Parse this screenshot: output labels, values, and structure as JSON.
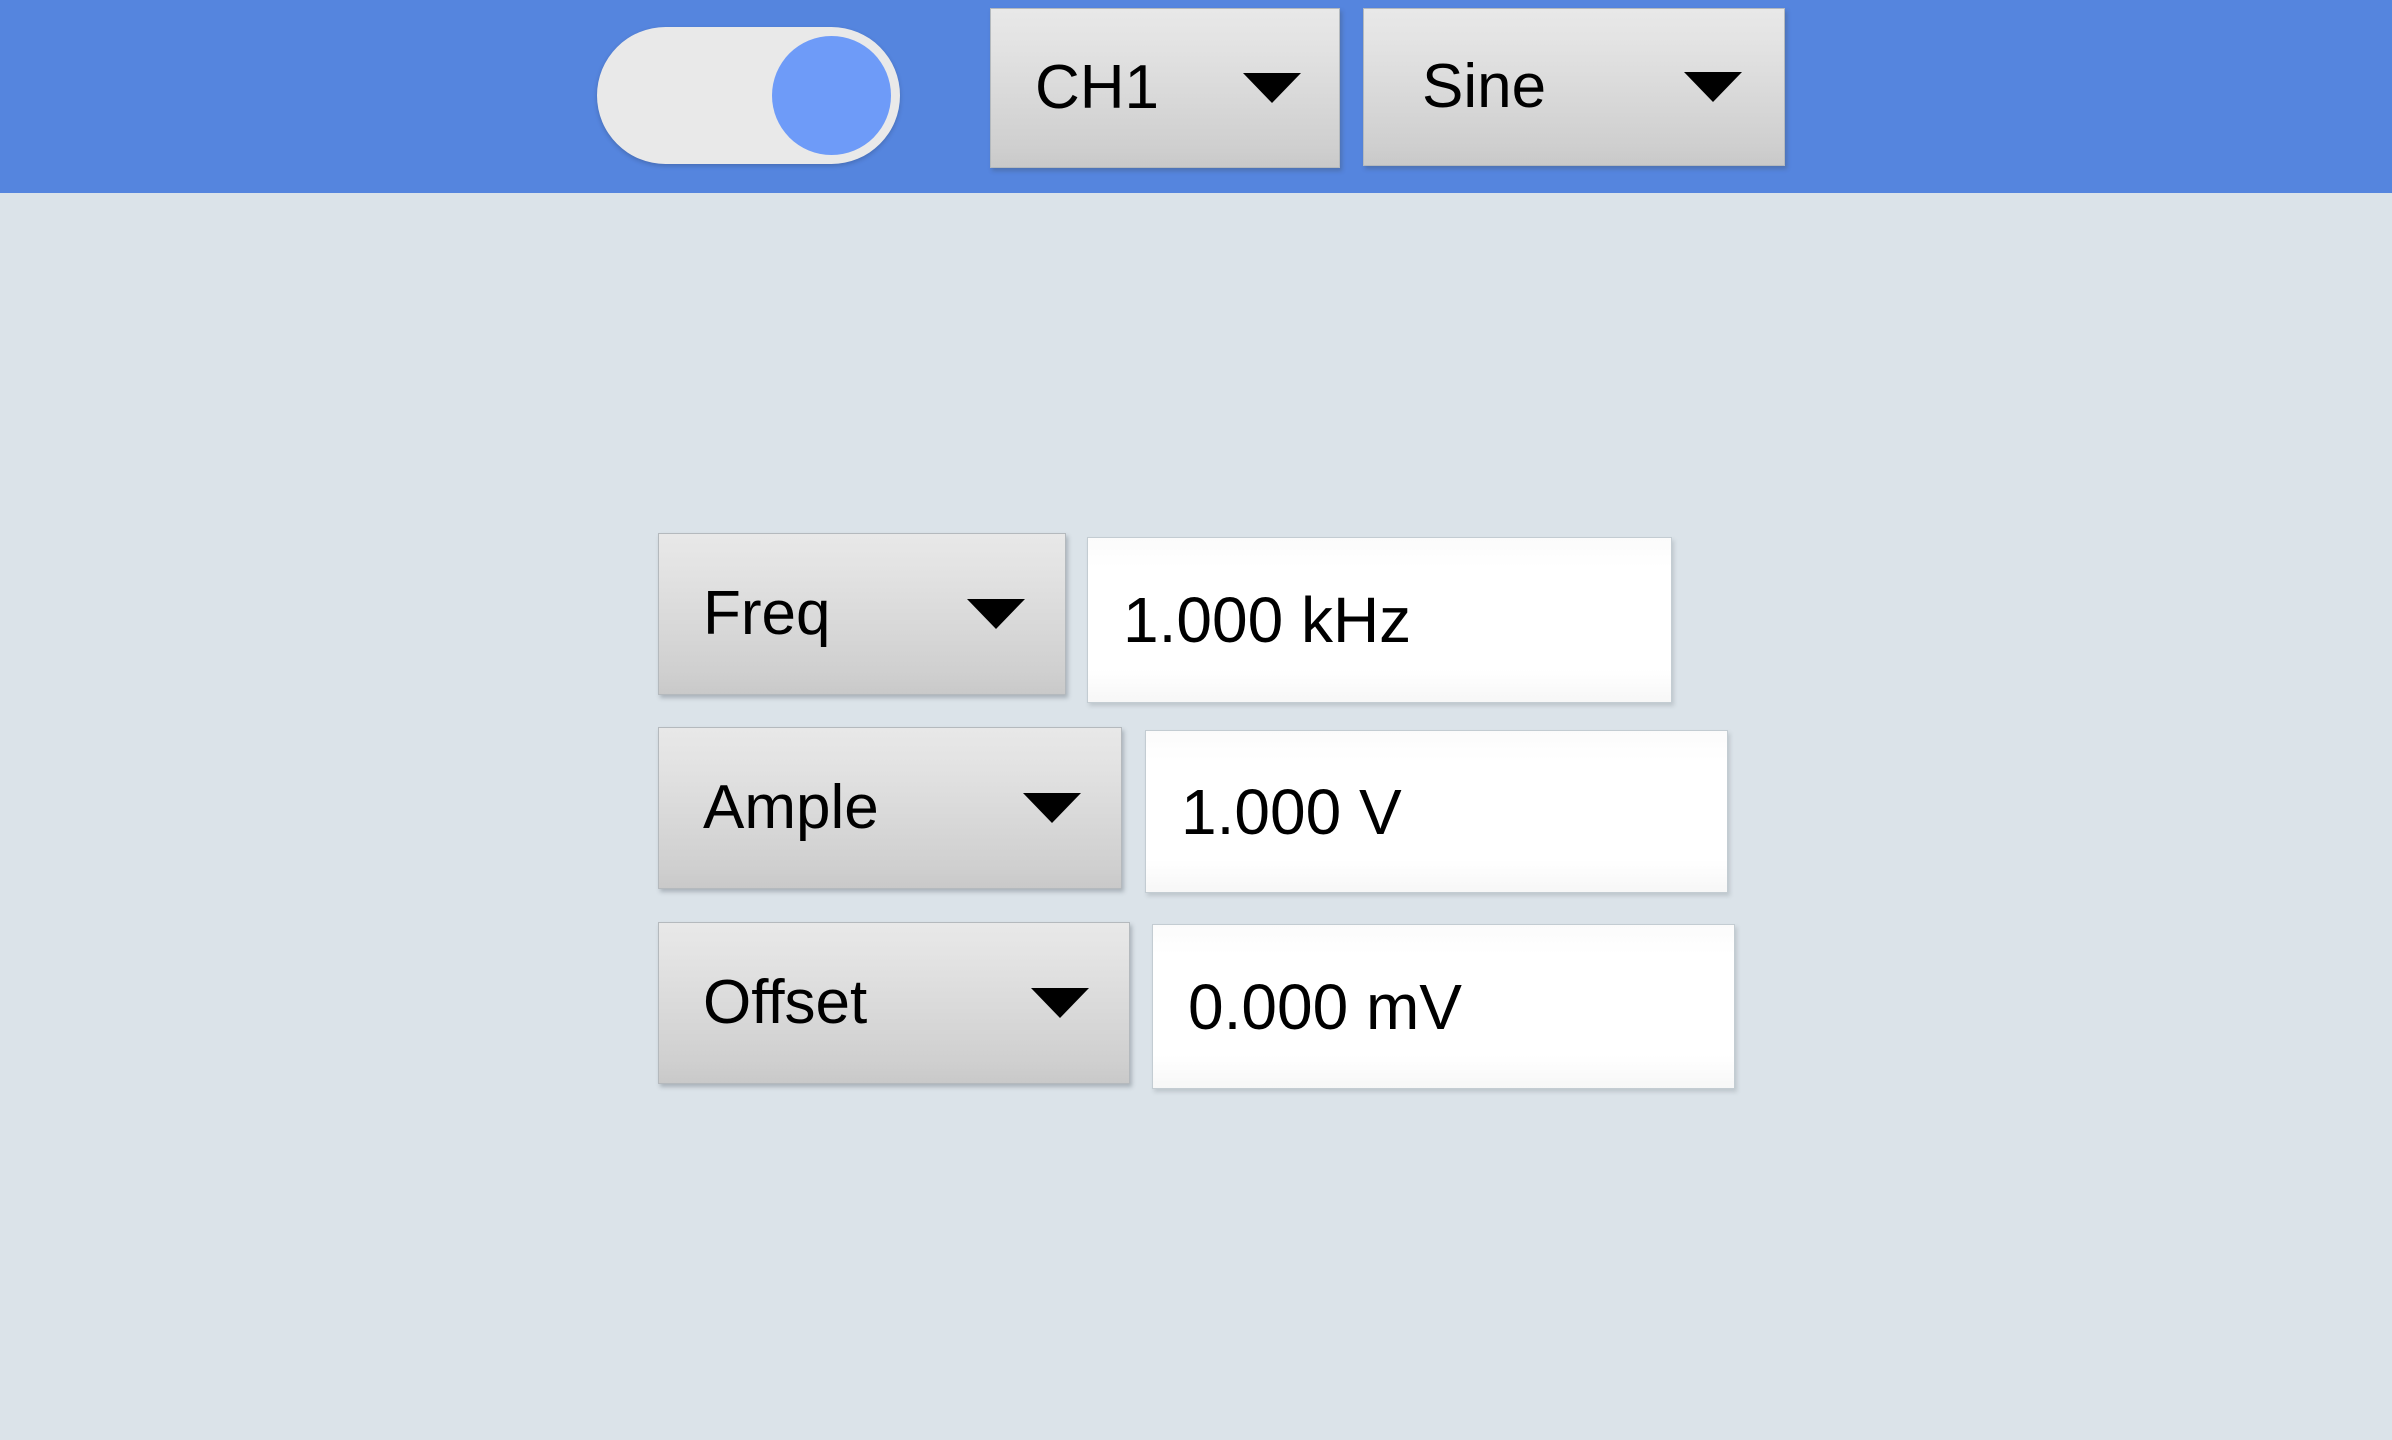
{
  "colors": {
    "header_bar": "#5585de",
    "page_background": "#dbe3e9",
    "toggle_track": "#e9e9e9",
    "toggle_thumb_on": "#6e9bf8",
    "button_face": "#d9d9d9",
    "value_field": "#ffffff",
    "text": "#000000"
  },
  "header": {
    "output_toggle": {
      "name": "output-enable-toggle",
      "state": "on"
    },
    "channel_selector": {
      "label": "CH1",
      "caret_icon": "chevron-down-icon"
    },
    "waveform_selector": {
      "label": "Sine",
      "caret_icon": "chevron-down-icon"
    }
  },
  "parameters": [
    {
      "key": "freq",
      "label": "Freq",
      "caret_icon": "chevron-down-icon",
      "value": "1.000 kHz"
    },
    {
      "key": "ample",
      "label": "Ample",
      "caret_icon": "chevron-down-icon",
      "value": "1.000 V"
    },
    {
      "key": "offset",
      "label": "Offset",
      "caret_icon": "chevron-down-icon",
      "value": "0.000 mV"
    }
  ]
}
